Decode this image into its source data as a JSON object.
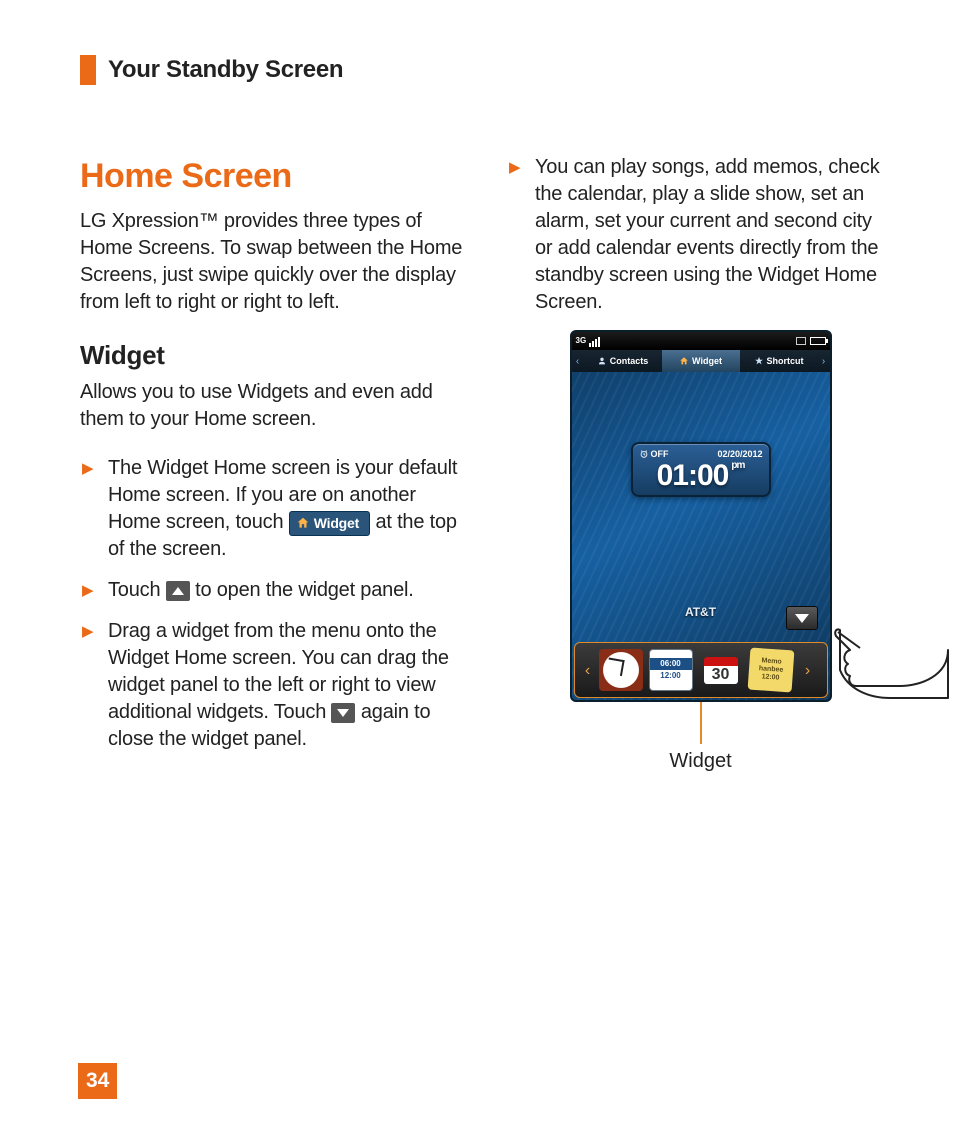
{
  "header": {
    "title": "Your Standby Screen"
  },
  "left": {
    "h1": "Home Screen",
    "intro": "LG Xpression™ provides three types of Home Screens. To swap between the Home Screens, just swipe quickly over the display from left to right or right to left.",
    "sub": "Widget",
    "subIntro": "Allows you to use Widgets and even add them to your Home screen.",
    "b1a": "The Widget Home screen is your default Home screen. If you are on another Home screen, touch ",
    "b1_btn": "Widget",
    "b1b": " at the top of the screen.",
    "b2a": "Touch ",
    "b2b": " to open the widget panel.",
    "b3a": "Drag a widget from the menu onto the Widget Home screen. You can drag the widget panel to the left or right to view additional widgets. Touch ",
    "b3b": " again to close the widget panel."
  },
  "right": {
    "b4": "You can play songs, add memos, check the calendar, play a slide show, set an alarm, set your current and second city or add calendar events directly from the standby screen using the Widget Home Screen.",
    "callout": "Widget"
  },
  "phone": {
    "threeg": "3G",
    "tabs": {
      "contacts": "Contacts",
      "widget": "Widget",
      "shortcut": "Shortcut"
    },
    "clock": {
      "off": "OFF",
      "date": "02/20/2012",
      "time": "01:00",
      "pm": "pm"
    },
    "carrier": "AT&T",
    "dual": {
      "t1": "06:00",
      "t2": "12:00"
    },
    "cal": {
      "day": "30"
    },
    "memo": {
      "l1": "Memo",
      "l2": "hanbee",
      "l3": "12:00"
    }
  },
  "page": "34"
}
